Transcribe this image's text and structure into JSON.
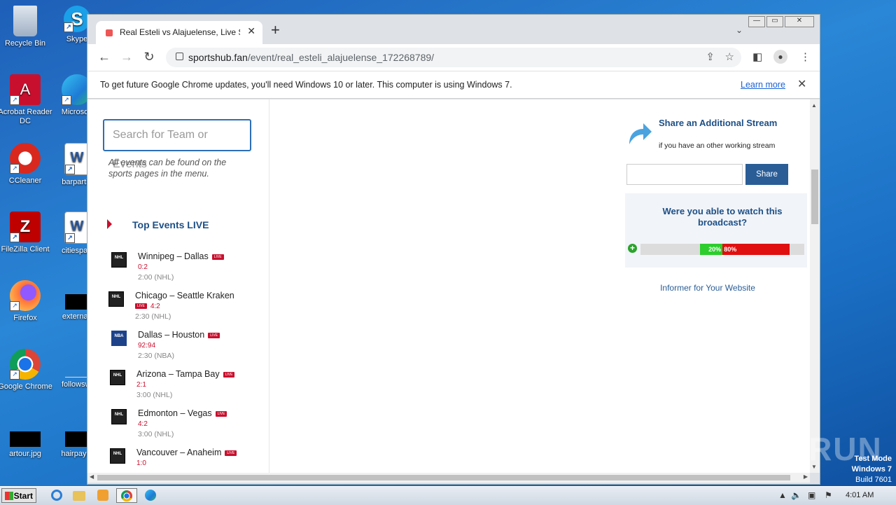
{
  "desktop": {
    "icons": [
      {
        "label": "Recycle Bin"
      },
      {
        "label": "Skype"
      },
      {
        "label": "Acrobat Reader DC"
      },
      {
        "label": "Microsoft"
      },
      {
        "label": "CCleaner"
      },
      {
        "label": "barpartie"
      },
      {
        "label": "FileZilla Client"
      },
      {
        "label": "citiespart"
      },
      {
        "label": "Firefox"
      },
      {
        "label": "externalt"
      },
      {
        "label": "Google Chrome"
      },
      {
        "label": "followswi"
      },
      {
        "label": "artour.jpg"
      },
      {
        "label": "hairpaym"
      }
    ]
  },
  "browser": {
    "tab_title": "Real Esteli vs Alajuelense, Live Score",
    "url_host": "sportshub.fan",
    "url_path": "/event/real_esteli_alajuelense_172268789/",
    "infobar_message": "To get future Google Chrome updates, you'll need Windows 10 or later. This computer is using Windows 7.",
    "infobar_link": "Learn more"
  },
  "page": {
    "search_placeholder": "Search for Team or Events",
    "search_hint": "All events can be found on the sports pages in the menu.",
    "top_events_title": "Top Events LIVE",
    "live_badge": "LIVE",
    "events": [
      {
        "league_logo": "NHL",
        "name": "Winnipeg – Dallas",
        "score": "0:2",
        "time": "2:00 (NHL)"
      },
      {
        "league_logo": "NHL",
        "name": "Chicago – Seattle Kraken",
        "score": "4:2",
        "time": "2:30 (NHL)"
      },
      {
        "league_logo": "NBA",
        "name": "Dallas – Houston",
        "score": "92:94",
        "time": "2:30 (NBA)"
      },
      {
        "league_logo": "NHL",
        "name": "Arizona – Tampa Bay",
        "score": "2:1",
        "time": "3:00 (NHL)"
      },
      {
        "league_logo": "NHL",
        "name": "Edmonton – Vegas",
        "score": "4:2",
        "time": "3:00 (NHL)"
      },
      {
        "league_logo": "NHL",
        "name": "Vancouver – Anaheim",
        "score": "1:0",
        "time": ""
      }
    ],
    "share_title": "Share an Additional Stream",
    "share_subtitle": "if you have an other working stream",
    "share_button": "Share",
    "poll_question": "Were you able to watch this broadcast?",
    "poll_yes_label": "20%",
    "poll_no_label": "80%",
    "poll_yes_fraction": 0.2,
    "poll_no_fraction": 0.8,
    "informer_link": "Informer for Your Website"
  },
  "taskbar": {
    "start_label": "Start",
    "clock": "4:01 AM"
  },
  "overlay": {
    "watermark": "ANY RUN",
    "test_mode_line1": "Test Mode",
    "test_mode_line2": "Windows 7",
    "test_mode_line3": "Build 7601"
  }
}
